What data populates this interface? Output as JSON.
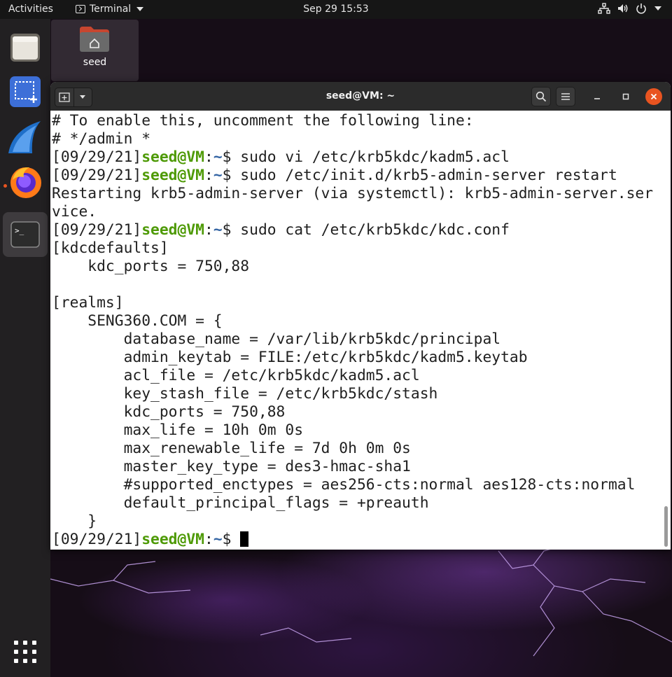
{
  "topbar": {
    "activities": "Activities",
    "app_menu": "Terminal",
    "clock": "Sep 29  15:53"
  },
  "dock": {
    "items": [
      "files-icon",
      "screenshot-icon",
      "wireshark-icon",
      "firefox-icon",
      "terminal-icon"
    ],
    "show_apps": "apps-grid-icon"
  },
  "desktop": {
    "home_folder_label": "seed"
  },
  "terminal": {
    "title": "seed@VM: ~",
    "prompt": {
      "date": "[09/29/21]",
      "userhost": "seed@VM",
      "sep": ":",
      "path": "~",
      "dollar": "$ "
    },
    "lines": [
      {
        "type": "text",
        "text": "# To enable this, uncomment the following line:"
      },
      {
        "type": "text",
        "text": "# */admin *"
      },
      {
        "type": "prompt",
        "cmd": "sudo vi /etc/krb5kdc/kadm5.acl"
      },
      {
        "type": "prompt",
        "cmd": "sudo /etc/init.d/krb5-admin-server restart"
      },
      {
        "type": "text",
        "text": "Restarting krb5-admin-server (via systemctl): krb5-admin-server.ser"
      },
      {
        "type": "text",
        "text": "vice."
      },
      {
        "type": "prompt",
        "cmd": "sudo cat /etc/krb5kdc/kdc.conf"
      },
      {
        "type": "text",
        "text": "[kdcdefaults]"
      },
      {
        "type": "text",
        "text": "    kdc_ports = 750,88"
      },
      {
        "type": "text",
        "text": ""
      },
      {
        "type": "text",
        "text": "[realms]"
      },
      {
        "type": "text",
        "text": "    SENG360.COM = {"
      },
      {
        "type": "text",
        "text": "        database_name = /var/lib/krb5kdc/principal"
      },
      {
        "type": "text",
        "text": "        admin_keytab = FILE:/etc/krb5kdc/kadm5.keytab"
      },
      {
        "type": "text",
        "text": "        acl_file = /etc/krb5kdc/kadm5.acl"
      },
      {
        "type": "text",
        "text": "        key_stash_file = /etc/krb5kdc/stash"
      },
      {
        "type": "text",
        "text": "        kdc_ports = 750,88"
      },
      {
        "type": "text",
        "text": "        max_life = 10h 0m 0s"
      },
      {
        "type": "text",
        "text": "        max_renewable_life = 7d 0h 0m 0s"
      },
      {
        "type": "text",
        "text": "        master_key_type = des3-hmac-sha1"
      },
      {
        "type": "text",
        "text": "        #supported_enctypes = aes256-cts:normal aes128-cts:normal"
      },
      {
        "type": "text",
        "text": "        default_principal_flags = +preauth"
      },
      {
        "type": "text",
        "text": "    }"
      },
      {
        "type": "prompt",
        "cmd": "",
        "cursor": true
      }
    ]
  },
  "colors": {
    "prompt_user": "#4e9a06",
    "prompt_path": "#3465a4",
    "close_button": "#e95420",
    "accent": "#e95420"
  }
}
